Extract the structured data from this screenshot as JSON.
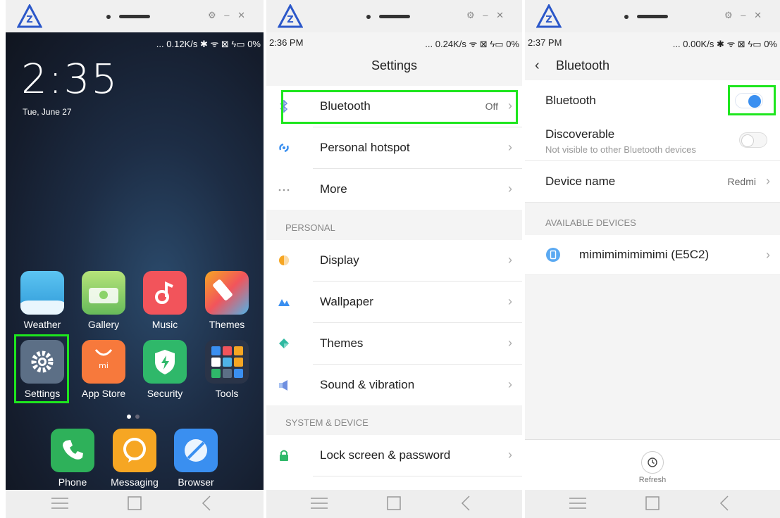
{
  "screens": [
    {
      "status": {
        "time": "",
        "right": "... 0.12K/s ✱ ᯤ ⊠ ϟ▭ 0%"
      },
      "clock": "2:35",
      "date": "Tue, June 27",
      "apps": [
        {
          "label": "Weather",
          "icon": "weather-icon",
          "color": "#4fb3e8"
        },
        {
          "label": "Gallery",
          "icon": "gallery-icon",
          "color": "#7cc66a"
        },
        {
          "label": "Music",
          "icon": "music-icon",
          "color": "#f2545b"
        },
        {
          "label": "Themes",
          "icon": "themes-icon",
          "color": "#f6a623"
        },
        {
          "label": "Settings",
          "icon": "gear-icon",
          "color": "#5c6f86"
        },
        {
          "label": "App Store",
          "icon": "app-store-icon",
          "color": "#f7793c"
        },
        {
          "label": "Security",
          "icon": "shield-icon",
          "color": "#2fb86a"
        },
        {
          "label": "Tools",
          "icon": "tools-folder-icon",
          "color": "#2a3448"
        }
      ],
      "dock": [
        {
          "label": "Phone",
          "icon": "phone-icon",
          "color": "#2eb15a"
        },
        {
          "label": "Messaging",
          "icon": "message-icon",
          "color": "#f6a623"
        },
        {
          "label": "Browser",
          "icon": "browser-icon",
          "color": "#3a8ff0"
        }
      ]
    },
    {
      "status": {
        "time": "2:36 PM",
        "right": "... 0.24K/s ᯤ ⊠ ϟ▭ 0%"
      },
      "title": "Settings",
      "group1": [
        {
          "label": "Bluetooth",
          "value": "Off",
          "icon": "bluetooth-icon"
        },
        {
          "label": "Personal hotspot",
          "value": "",
          "icon": "hotspot-icon"
        },
        {
          "label": "More",
          "value": "",
          "icon": "more-dots-icon"
        }
      ],
      "section_personal": "PERSONAL",
      "group2": [
        {
          "label": "Display",
          "icon": "display-icon"
        },
        {
          "label": "Wallpaper",
          "icon": "wallpaper-icon"
        },
        {
          "label": "Themes",
          "icon": "themes-icon"
        },
        {
          "label": "Sound & vibration",
          "icon": "sound-icon"
        }
      ],
      "section_system": "SYSTEM & DEVICE",
      "group3": [
        {
          "label": "Lock screen & password",
          "icon": "lock-icon"
        }
      ]
    },
    {
      "status": {
        "time": "2:37 PM",
        "right": "... 0.00K/s ✱ ᯤ ⊠ ϟ▭ 0%"
      },
      "back": "‹",
      "title": "Bluetooth",
      "bluetooth_label": "Bluetooth",
      "bluetooth_on": true,
      "discoverable_label": "Discoverable",
      "discoverable_sub": "Not visible to other Bluetooth devices",
      "discoverable_on": false,
      "device_name_label": "Device name",
      "device_name_value": "Redmi",
      "section_available": "AVAILABLE DEVICES",
      "device": "mimimimimimimi (E5C2)",
      "refresh": "Refresh"
    }
  ],
  "colors": {
    "highlight": "#1ee61e",
    "toggle_on": "#3a8ff0",
    "bluetooth_icon": "#6f8fe0"
  }
}
